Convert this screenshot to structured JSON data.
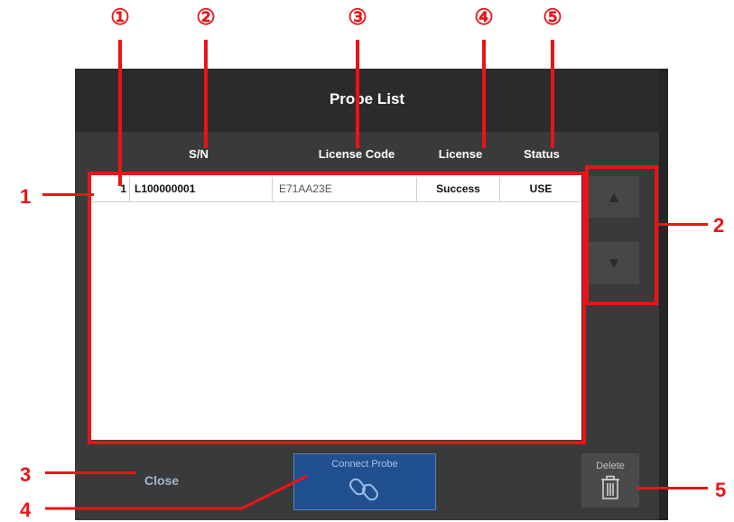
{
  "dialog": {
    "title": "Probe List"
  },
  "columns": {
    "sn": "S/N",
    "license_code": "License Code",
    "license": "License",
    "status": "Status"
  },
  "rows": [
    {
      "index": "1",
      "sn": "L100000001",
      "license_code": "E71AA23E",
      "license": "Success",
      "status": "USE"
    }
  ],
  "nav": {
    "up_icon": "triangle-up",
    "down_icon": "triangle-down"
  },
  "buttons": {
    "close": "Close",
    "connect": "Connect Probe",
    "delete": "Delete"
  },
  "annotations": {
    "circled": [
      "①",
      "②",
      "③",
      "④",
      "⑤"
    ],
    "numbers": [
      "1",
      "2",
      "3",
      "4",
      "5"
    ]
  },
  "colors": {
    "highlight": "#e8141a",
    "connect_button": "#20508f",
    "dialog_bg": "#3a3a3a"
  }
}
